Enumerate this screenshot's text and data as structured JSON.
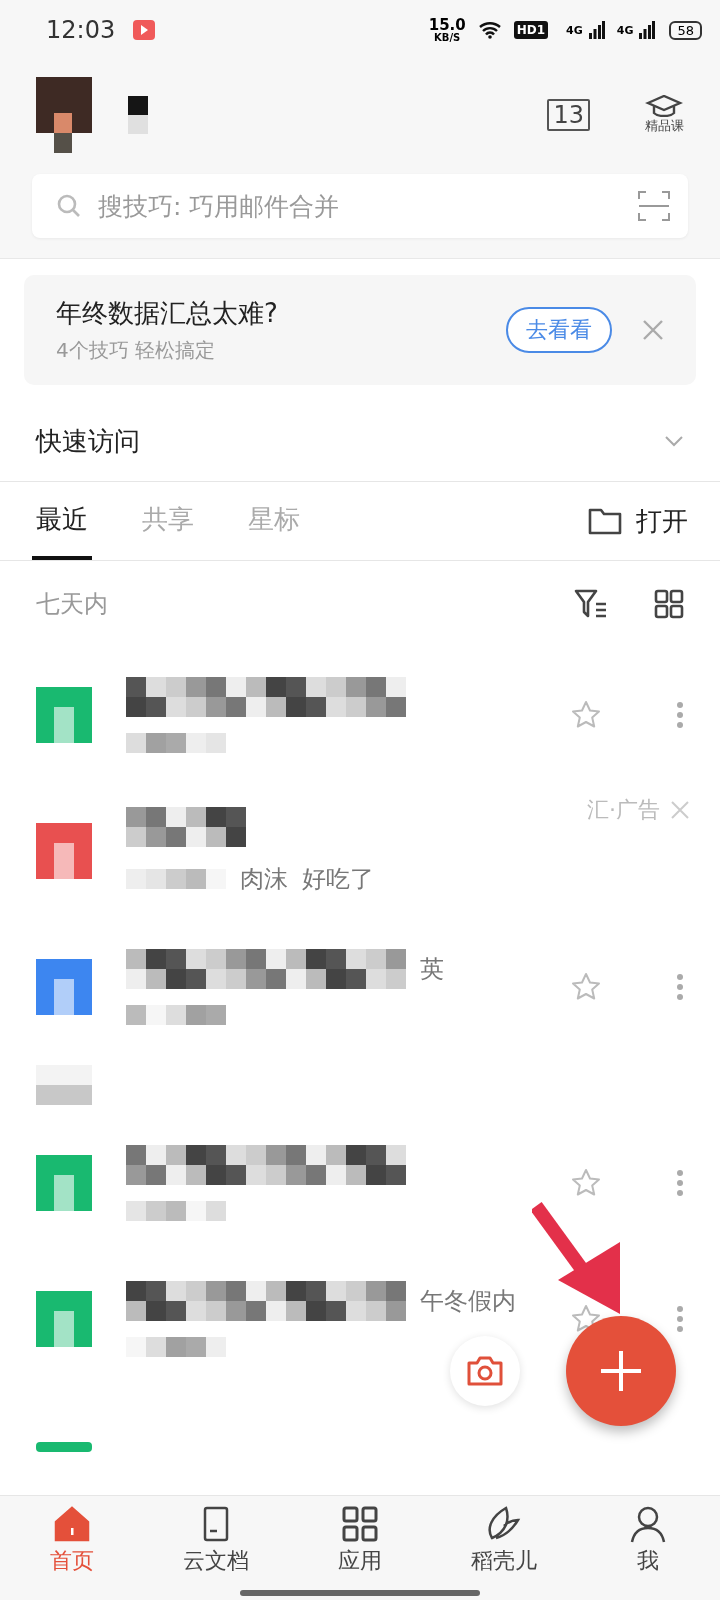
{
  "status_bar": {
    "time": "12:03",
    "speed": "15.0",
    "speed_unit": "KB/S",
    "hd": "HD1",
    "networks": [
      "4G",
      "4G"
    ],
    "battery": "58"
  },
  "header": {
    "calendar_day": "13",
    "course_label": "精品课"
  },
  "search": {
    "placeholder": "搜技巧: 巧用邮件合并"
  },
  "banner": {
    "title": "年终数据汇总太难?",
    "subtitle": "4个技巧 轻松搞定",
    "button": "去看看"
  },
  "quick_access": {
    "label": "快速访问",
    "expanded": false
  },
  "tabs": [
    {
      "label": "最近",
      "selected": true
    },
    {
      "label": "共享",
      "selected": false
    },
    {
      "label": "星标",
      "selected": false
    }
  ],
  "open_button": "打开",
  "section_label": "七天内",
  "files": [
    {
      "kind": "file",
      "color": "#19b970",
      "starred": false
    },
    {
      "kind": "ad",
      "color": "#e85050",
      "ad_label": "汇·广告",
      "snippets": [
        "肉沫",
        "好吃了"
      ]
    },
    {
      "kind": "file",
      "color": "#3d86f0",
      "starred": false,
      "snippet": "英"
    },
    {
      "kind": "fragment",
      "color": "#c8c8c8"
    },
    {
      "kind": "file",
      "color": "#19b970",
      "starred": false
    },
    {
      "kind": "file",
      "color": "#19b970",
      "starred": false,
      "snippet": "午冬假内"
    }
  ],
  "bottom_nav": [
    {
      "label": "首页",
      "selected": true
    },
    {
      "label": "云文档",
      "selected": false
    },
    {
      "label": "应用",
      "selected": false
    },
    {
      "label": "稻壳儿",
      "selected": false
    },
    {
      "label": "我",
      "selected": false
    }
  ]
}
